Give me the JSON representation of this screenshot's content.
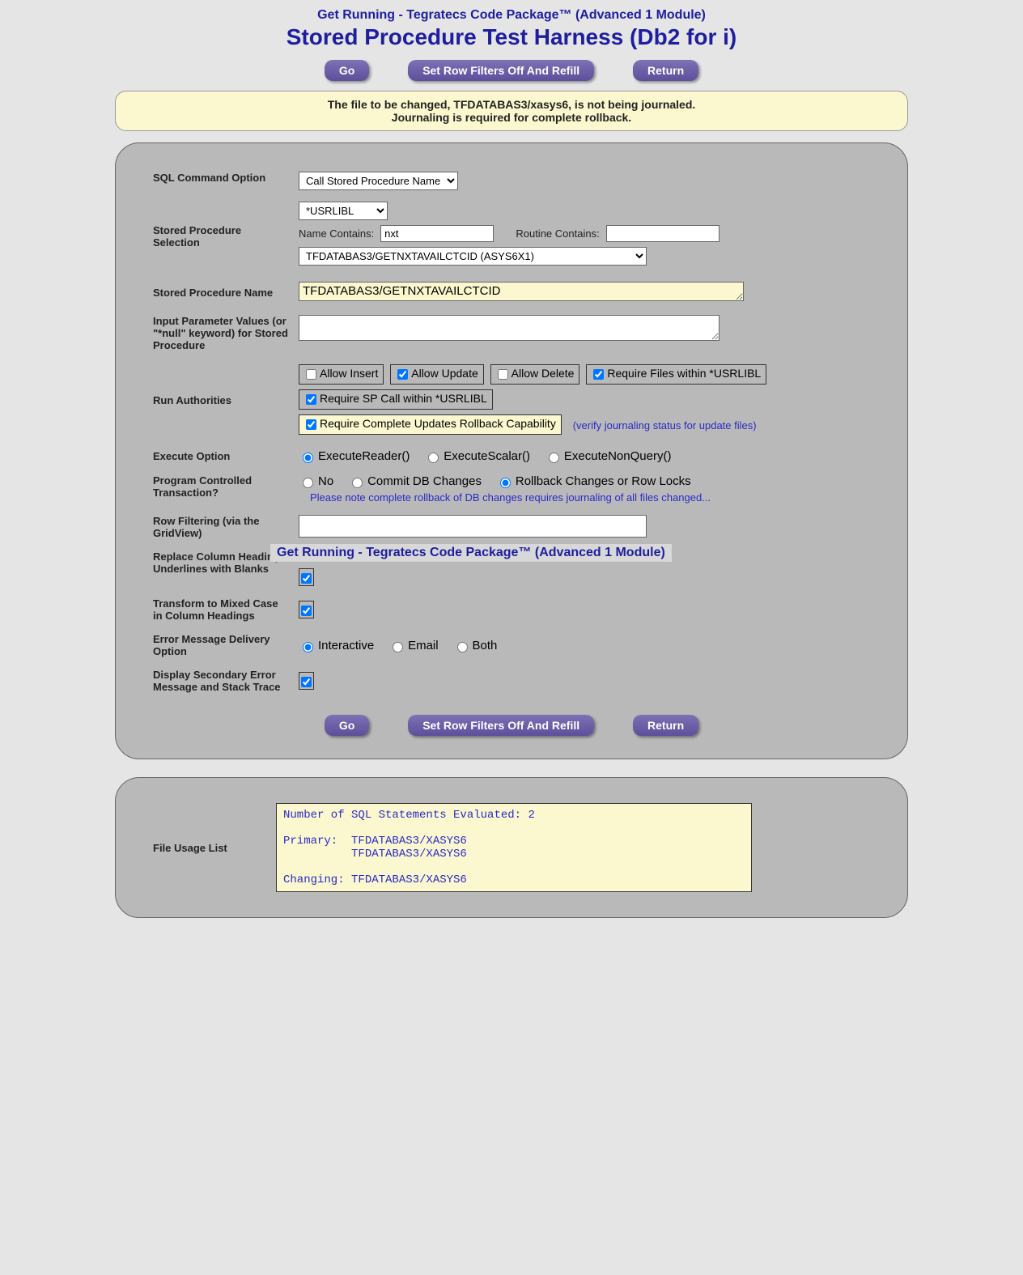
{
  "title": {
    "small": "Get Running - Tegratecs Code Package™ (Advanced 1 Module)",
    "large": "Stored Procedure Test Harness (Db2 for i)"
  },
  "buttons": {
    "go": "Go",
    "set_filters": "Set Row Filters Off And Refill",
    "return": "Return"
  },
  "banner": {
    "line1": "The file to be changed, TFDATABAS3/xasys6, is not being journaled.",
    "line2": "Journaling is required for complete rollback."
  },
  "labels": {
    "sql_cmd": "SQL Command Option",
    "sp_select": "Stored Procedure Selection",
    "sp_name": "Stored Procedure Name",
    "ipv": "Input Parameter Values (or \"*null\" keyword) for Stored Procedure",
    "run_auth": "Run Authorities",
    "exec_opt": "Execute Option",
    "prog_trans": "Program Controlled Transaction?",
    "row_filter": "Row Filtering (via the GridView)",
    "replace_col": "Replace Column Heading Underlines with Blanks",
    "mixed_case": "Transform to Mixed Case in Column Headings",
    "err_delivery": "Error Message Delivery Option",
    "secondary_err": "Display Secondary Error Message and Stack Trace",
    "file_usage": "File Usage List",
    "name_contains": "Name Contains:",
    "routine_contains": "Routine Contains:"
  },
  "fields": {
    "sql_cmd_value": "Call Stored Procedure Name",
    "lib_value": "*USRLIBL",
    "name_contains_value": "nxt",
    "routine_contains_value": "",
    "sp_dropdown_value": "TFDATABAS3/GETNXTAVAILCTCID (ASYS6X1)",
    "sp_name_value": "TFDATABAS3/GETNXTAVAILCTCID",
    "ipv_value": "",
    "row_filter_value": ""
  },
  "run_authorities": {
    "allow_insert": {
      "label": "Allow Insert",
      "checked": false
    },
    "allow_update": {
      "label": "Allow Update",
      "checked": true
    },
    "allow_delete": {
      "label": "Allow Delete",
      "checked": false
    },
    "require_files": {
      "label": "Require Files within *USRLIBL",
      "checked": true
    },
    "require_sp": {
      "label": "Require SP Call within *USRLIBL",
      "checked": true
    },
    "require_rollback": {
      "label": "Require Complete Updates Rollback Capability",
      "checked": true
    },
    "verify_link": "(verify journaling status for update files)"
  },
  "exec_options": {
    "reader": "ExecuteReader()",
    "scalar": "ExecuteScalar()",
    "nonquery": "ExecuteNonQuery()",
    "selected": "reader"
  },
  "prog_trans": {
    "no": "No",
    "commit": "Commit DB Changes",
    "rollback": "Rollback Changes or Row Locks",
    "selected": "rollback",
    "note": "Please note complete rollback of DB changes requires journaling of all files changed..."
  },
  "overlay_badge": "Get Running - Tegratecs Code Package™ (Advanced 1 Module)",
  "checkboxes": {
    "replace_col": true,
    "mixed_case": true,
    "secondary_err": true
  },
  "err_delivery": {
    "interactive": "Interactive",
    "email": "Email",
    "both": "Both",
    "selected": "interactive"
  },
  "file_usage_text": "Number of SQL Statements Evaluated: 2\n\nPrimary:  TFDATABAS3/XASYS6\n          TFDATABAS3/XASYS6\n\nChanging: TFDATABAS3/XASYS6"
}
